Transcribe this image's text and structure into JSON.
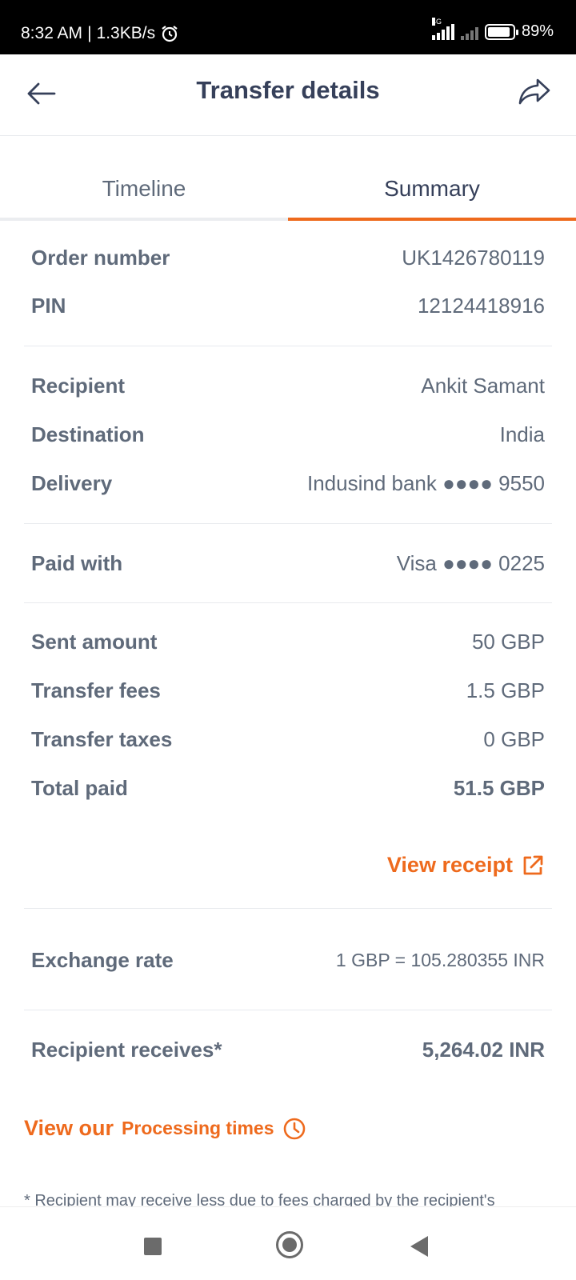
{
  "status_bar": {
    "time": "8:32 AM",
    "speed": "1.3KB/s",
    "network_type": "4G",
    "battery": "89%",
    "battery_level": 0.89
  },
  "header": {
    "title": "Transfer details",
    "back_icon": "arrow-left-icon",
    "share_icon": "share-icon"
  },
  "tabs": [
    {
      "label": "Timeline",
      "active": false
    },
    {
      "label": "Summary",
      "active": true
    }
  ],
  "order": {
    "order_number_label": "Order number",
    "order_number": "UK1426780119",
    "pin_label": "PIN",
    "pin": "12124418916"
  },
  "recipient": {
    "recipient_label": "Recipient",
    "recipient": "Ankit Samant",
    "destination_label": "Destination",
    "destination": "India",
    "delivery_label": "Delivery",
    "delivery": "Indusind bank ●●●● 9550"
  },
  "payment": {
    "paid_with_label": "Paid with",
    "paid_with": "Visa ●●●● 0225"
  },
  "amounts": {
    "sent_label": "Sent amount",
    "sent": "50 GBP",
    "fees_label": "Transfer fees",
    "fees": "1.5 GBP",
    "taxes_label": "Transfer taxes",
    "taxes": "0 GBP",
    "total_label": "Total paid",
    "total": "51.5 GBP"
  },
  "receipt_link": "View receipt",
  "exchange": {
    "label": "Exchange rate",
    "value": "1 GBP = 105.280355 INR"
  },
  "receives": {
    "label": "Recipient receives*",
    "value": "5,264.02 INR"
  },
  "processing_link": {
    "prefix": "View our",
    "text": "Processing times"
  },
  "footnote": "* Recipient may receive less due to fees charged by the recipient's"
}
